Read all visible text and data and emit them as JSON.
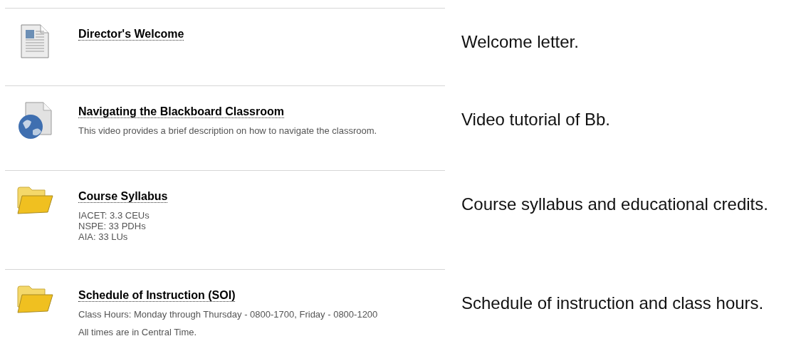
{
  "items": [
    {
      "kind": "document",
      "title": "Director's Welcome",
      "note": "Welcome letter."
    },
    {
      "kind": "video",
      "title": "Navigating the Blackboard Classroom",
      "paragraphs": [
        "This video provides a brief description on how to navigate the classroom."
      ],
      "note": "Video tutorial of Bb."
    },
    {
      "kind": "folder",
      "title": "Course Syllabus",
      "paragraphs": [
        "IACET: 3.3 CEUs\nNSPE: 33 PDHs\nAIA: 33 LUs"
      ],
      "note": "Course syllabus and educational credits."
    },
    {
      "kind": "folder",
      "title": "Schedule of Instruction (SOI)",
      "paragraphs": [
        "Class Hours: Monday through Thursday - 0800-1700, Friday - 0800-1200",
        "All times are in Central Time."
      ],
      "note": "Schedule of instruction and class hours."
    }
  ]
}
